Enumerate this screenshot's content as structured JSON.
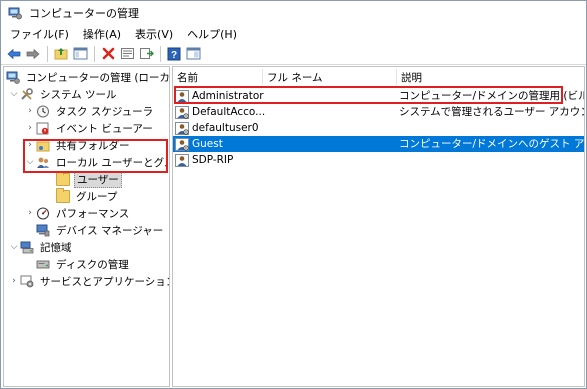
{
  "window": {
    "title": "コンピューターの管理"
  },
  "menu": [
    "ファイル(F)",
    "操作(A)",
    "表示(V)",
    "ヘルプ(H)"
  ],
  "toolbar": {
    "icons": [
      "back-arrow-icon",
      "forward-arrow-icon",
      "up-folder-icon",
      "show-tree-icon",
      "delete-icon",
      "properties-icon",
      "export-list-icon",
      "help-icon",
      "console-view-icon"
    ]
  },
  "tree": {
    "root": "コンピューターの管理 (ローカル)",
    "system_tools": "システム ツール",
    "task_scheduler": "タスク スケジューラ",
    "event_viewer": "イベント ビューアー",
    "shared_folders": "共有フォルダー",
    "local_users_groups": "ローカル ユーザーとグループ",
    "users": "ユーザー",
    "groups": "グループ",
    "performance": "パフォーマンス",
    "device_manager": "デバイス マネージャー",
    "storage": "記憶域",
    "disk_management": "ディスクの管理",
    "services_apps": "サービスとアプリケーション"
  },
  "list": {
    "columns": [
      "名前",
      "フル ネーム",
      "説明"
    ],
    "rows": [
      {
        "name": "Administrator",
        "full_name": "",
        "description": "コンピューター/ドメインの管理用 (ビルト..."
      },
      {
        "name": "DefaultAcco...",
        "full_name": "",
        "description": "システムで管理されるユーザー アカウン..."
      },
      {
        "name": "defaultuser0",
        "full_name": "",
        "description": ""
      },
      {
        "name": "Guest",
        "full_name": "",
        "description": "コンピューター/ドメインへのゲスト アクセ..."
      },
      {
        "name": "SDP-RIP",
        "full_name": "",
        "description": ""
      }
    ],
    "selected_row": "Guest"
  },
  "colors": {
    "selection": "#0078d7",
    "highlight_box": "#e02020"
  }
}
